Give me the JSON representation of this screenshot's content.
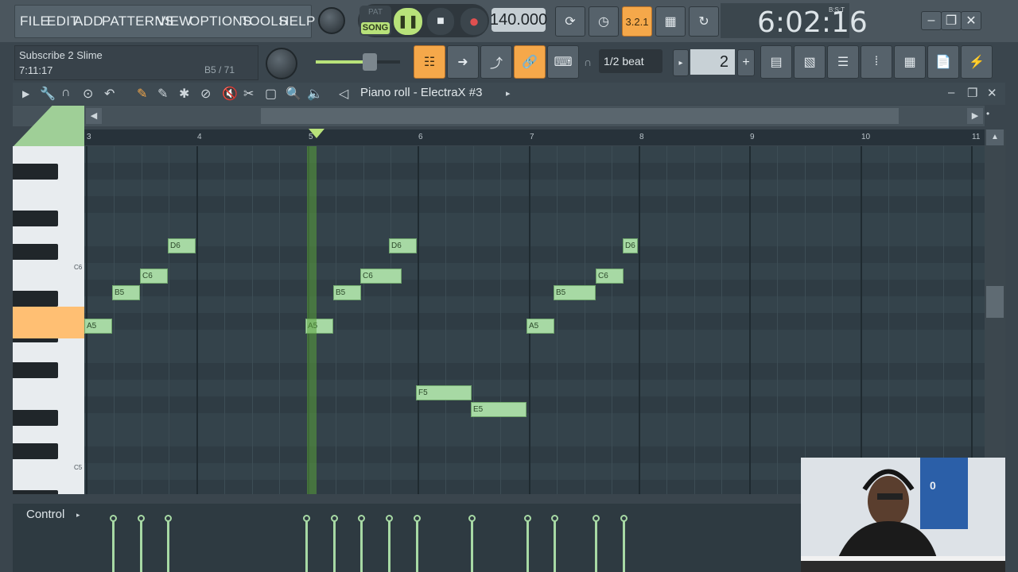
{
  "menu": [
    "FILE",
    "EDIT",
    "ADD",
    "PATTERNS",
    "VIEW",
    "OPTIONS",
    "TOOLS",
    "HELP"
  ],
  "info": {
    "line1": "Subscribe 2 Slime",
    "line2": "7:11:17",
    "note": "B5 / 71"
  },
  "transport": {
    "pat": "PAT",
    "song": "SONG",
    "tempo": "140.000"
  },
  "clock": {
    "time": "6:02:16",
    "label": "B:S:T"
  },
  "snap": "1/2 beat",
  "step": "2",
  "piano_roll": {
    "title": "Piano roll - ElectraX #3"
  },
  "ruler": [
    "3",
    "4",
    "5",
    "6",
    "7",
    "8",
    "9",
    "10",
    "11"
  ],
  "key_labels": [
    "C6",
    "C5"
  ],
  "notes": [
    {
      "name": "D6"
    },
    {
      "name": "D6"
    },
    {
      "name": "D6"
    },
    {
      "name": "C6"
    },
    {
      "name": "C6"
    },
    {
      "name": "C6"
    },
    {
      "name": "B5"
    },
    {
      "name": "B5"
    },
    {
      "name": "B5"
    },
    {
      "name": "A5"
    },
    {
      "name": "A5"
    },
    {
      "name": "A5"
    },
    {
      "name": "F5"
    },
    {
      "name": "E5"
    }
  ],
  "control": {
    "label": "Control"
  },
  "colors": {
    "accent": "#f5a84a",
    "note": "#a7d9a4",
    "song": "#b8e27a"
  }
}
